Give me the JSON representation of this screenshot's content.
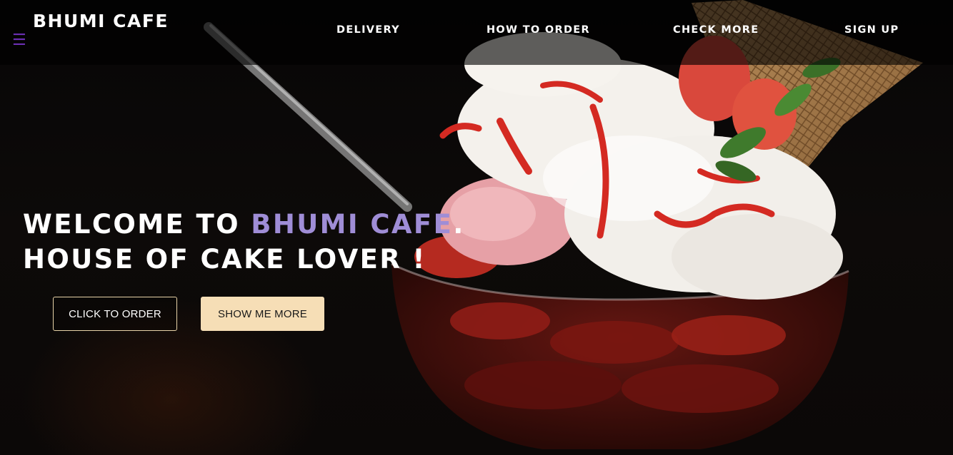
{
  "brand": {
    "name": "BHUMI CAFE"
  },
  "menu_icon": "hamburger-menu-icon",
  "nav": {
    "delivery": "DELIVERY",
    "how_to_order": "HOW TO ORDER",
    "check_more": "CHECK MORE",
    "sign_up": "SIGN UP"
  },
  "hero": {
    "line1_prefix": "WELCOME TO ",
    "line1_accent": "BHUMI CAFE",
    "line1_suffix": ".",
    "line2": "HOUSE OF CAKE LOVER !",
    "image": "strawberry-sundae-image"
  },
  "buttons": {
    "order": "CLICK TO ORDER",
    "more": "SHOW ME MORE"
  },
  "colors": {
    "accent": "#9f8dd6",
    "menu_icon": "#6b2fb3",
    "button_cream": "#f6deb6",
    "button_border": "#e8d3a8"
  }
}
